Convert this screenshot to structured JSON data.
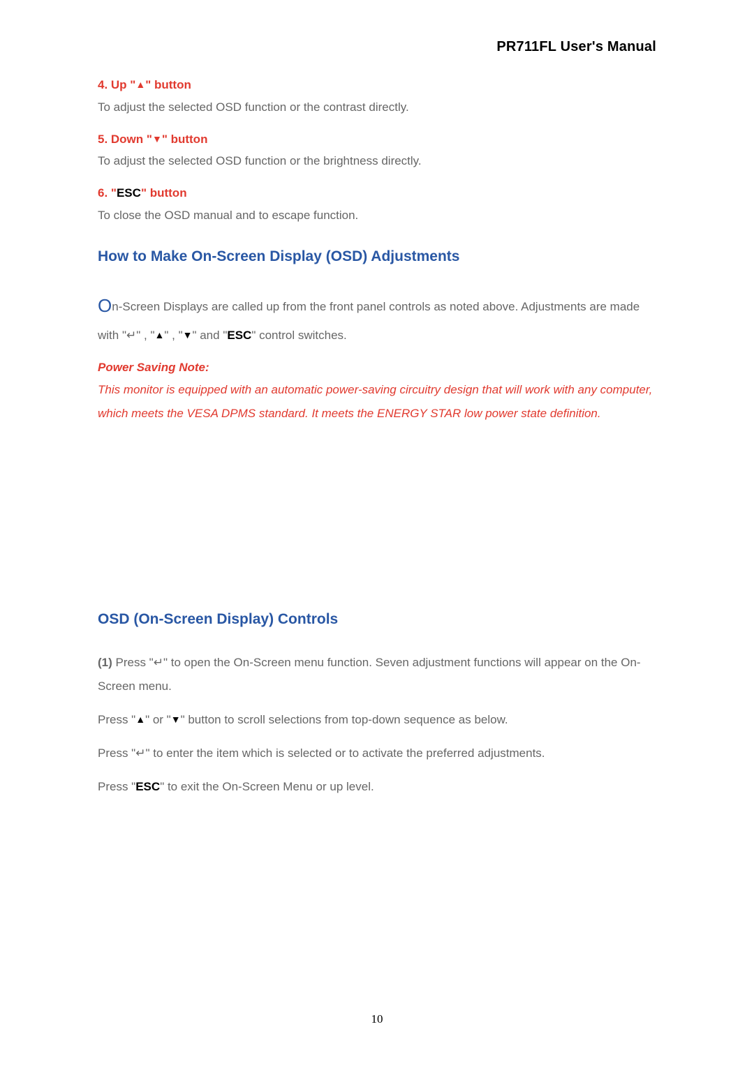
{
  "header": {
    "title": "PR711FL User's Manual"
  },
  "sections": {
    "up": {
      "title_pre": "4. Up \"",
      "title_post": "\" button",
      "body": "To adjust the selected OSD function or the contrast directly."
    },
    "down": {
      "title_pre": "5. Down \"",
      "title_post": "\" button",
      "body": "To adjust the selected OSD function or the brightness directly."
    },
    "esc": {
      "title_pre": "6. \"",
      "title_esc": "ESC",
      "title_post": "\" button",
      "body": "To close the OSD manual and to escape function."
    }
  },
  "osd_adjust": {
    "heading": "How to Make On-Screen Display (OSD) Adjustments",
    "para1_a": "n-Screen Displays are called up from the front panel controls as noted above. Adjustments are made with \"",
    "para1_b": "\" , \"",
    "para1_c": "\" , \"",
    "para1_d": "\" and \"",
    "para1_esc": "ESC",
    "para1_end": "\" control switches."
  },
  "power_note": {
    "title": "Power Saving Note:",
    "body": "This monitor is equipped with an automatic power-saving circuitry design that will work with any computer, which meets the VESA DPMS standard. It meets the ENERGY STAR low power state definition."
  },
  "osd_controls": {
    "heading": "OSD (On-Screen Display) Controls",
    "step1_label": "(1) ",
    "step1_a": "Press \"",
    "step1_b": "\" to open the On-Screen menu function. Seven adjustment functions will appear on the On-Screen menu.",
    "p2_a": "Press \"",
    "p2_b": "\" or \"",
    "p2_c": "\" button to scroll selections from top-down sequence as below.",
    "p3_a": "Press \"",
    "p3_b": "\" to enter the item which is selected or to activate the preferred adjustments.",
    "p4_a": "Press \"",
    "p4_esc": "ESC",
    "p4_b": "\" to exit the On-Screen Menu or up level."
  },
  "icons": {
    "up": "▲",
    "down": "▼",
    "enter": "↵",
    "dropcap": "O"
  },
  "page_number": "10"
}
